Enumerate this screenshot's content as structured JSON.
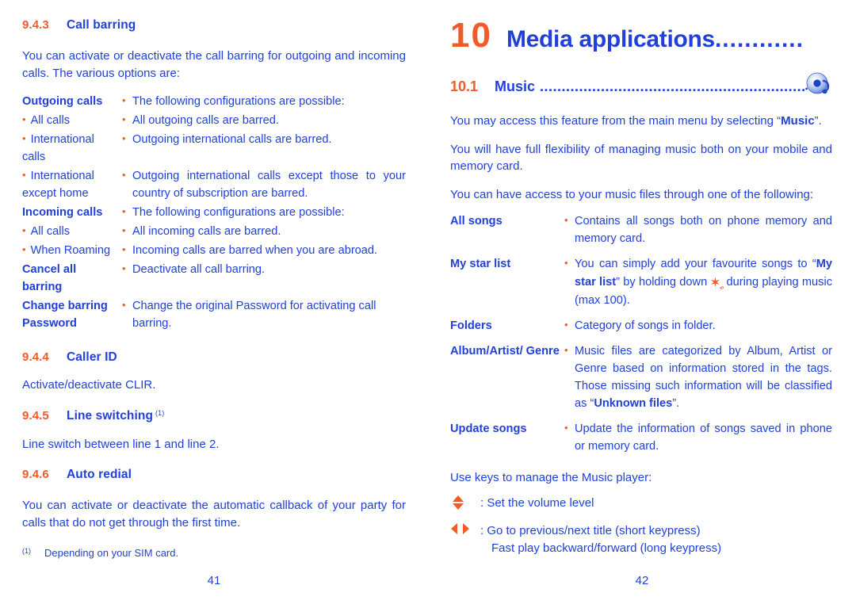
{
  "colors": {
    "accent_orange": "#F15B29",
    "text_blue": "#2040D8",
    "page_background": "#FFFFFF"
  },
  "left_page": {
    "folio": "41",
    "sections": {
      "call_barring": {
        "number": "9.4.3",
        "title": "Call barring",
        "intro": "You can activate or deactivate the call barring for outgoing and incoming calls. The various options are:",
        "rows": [
          {
            "term": "Outgoing calls",
            "term_bold": true,
            "term_bullet": false,
            "desc": "The following configurations are possible:",
            "desc_bullet": true
          },
          {
            "term": "All calls",
            "term_bold": false,
            "term_bullet": true,
            "desc": "All outgoing calls are barred.",
            "desc_bullet": true
          },
          {
            "term": "International calls",
            "term_bold": false,
            "term_bullet": true,
            "desc": "Outgoing international calls are barred.",
            "desc_bullet": true
          },
          {
            "term": "International except home",
            "term_bold": false,
            "term_bullet": true,
            "desc": "Outgoing international calls except those to your country of subscription are barred.",
            "desc_bullet": true
          },
          {
            "term": "Incoming calls",
            "term_bold": true,
            "term_bullet": false,
            "desc": "The following configurations are possible:",
            "desc_bullet": true
          },
          {
            "term": "All calls",
            "term_bold": false,
            "term_bullet": true,
            "desc": "All incoming calls are barred.",
            "desc_bullet": true
          },
          {
            "term": "When Roaming",
            "term_bold": false,
            "term_bullet": true,
            "desc": "Incoming calls are barred when you are abroad.",
            "desc_bullet": true
          },
          {
            "term": "Cancel all barring",
            "term_bold": true,
            "term_bullet": false,
            "desc": "Deactivate all call barring.",
            "desc_bullet": true
          },
          {
            "term": "Change barring Password",
            "term_bold": true,
            "term_bullet": false,
            "desc": "Change the original Password for activating call barring.",
            "desc_bullet": true
          }
        ]
      },
      "caller_id": {
        "number": "9.4.4",
        "title": "Caller ID",
        "body": "Activate/deactivate CLIR."
      },
      "line_switching": {
        "number": "9.4.5",
        "title": "Line switching",
        "footnote_mark": "(1)",
        "body": "Line switch between line 1 and line 2."
      },
      "auto_redial": {
        "number": "9.4.6",
        "title": "Auto redial",
        "body": "You can activate or deactivate the automatic callback of your party for calls that do not get through the first time."
      }
    },
    "footnote": {
      "mark": "(1)",
      "text": "Depending on your SIM card."
    }
  },
  "right_page": {
    "folio": "42",
    "chapter": {
      "number": "10",
      "title": "Media applications",
      "dots": "............"
    },
    "subchapter": {
      "number": "10.1",
      "title": "Music",
      "dots": ".............................................................",
      "icon": "music-cd-icon"
    },
    "paragraphs": [
      {
        "prefix": "You may access this feature from the main menu by selecting “",
        "bold": "Music",
        "suffix": "”."
      },
      {
        "prefix": "You will have full flexibility of managing music both on your mobile and memory card.",
        "bold": "",
        "suffix": ""
      },
      {
        "prefix": "You can have access to your music files through one of the following:",
        "bold": "",
        "suffix": ""
      }
    ],
    "rows": [
      {
        "term": "All songs",
        "desc_html": "Contains all songs both on phone memory and memory card."
      },
      {
        "term": "My star list",
        "desc_html": "You can simply add your favourite songs to “<b>My star list</b>” by holding down <span class=\"starkey\" data-name=\"star-key-icon\">✶<span class=\"dots\">,₀</span></span> during playing music (max 100)."
      },
      {
        "term": "Folders",
        "desc_html": "Category of songs in folder."
      },
      {
        "term": "Album/Artist/ Genre",
        "desc_html": "Music files are categorized by Album, Artist or Genre based on information stored in the tags. Those missing such information will be classified as “<b>Unknown files</b>”."
      },
      {
        "term": "Update songs",
        "desc_html": "Update the information of songs saved in phone or memory card."
      }
    ],
    "keys_intro": "Use keys to manage the Music player:",
    "keys": [
      {
        "icon": "volume-updown-arrows-icon",
        "line1": ": Set the volume level",
        "line2": ""
      },
      {
        "icon": "prev-next-arrows-icon",
        "line1": ": Go to previous/next title (short keypress)",
        "line2": "Fast play backward/forward (long keypress)"
      }
    ]
  }
}
